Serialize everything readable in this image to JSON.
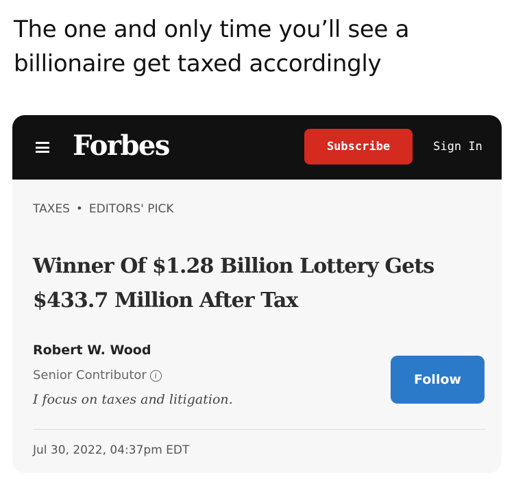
{
  "caption": {
    "line1": "The one and only time you’ll see a",
    "line2": "billionaire get taxed accordingly"
  },
  "navbar": {
    "logo": "Forbes",
    "subscribe_label": "Subscribe",
    "signin_label": "Sign In",
    "menu_icon": "hamburger-menu-icon",
    "background_color": "#111111",
    "subscribe_color": "#d42a1f"
  },
  "article": {
    "tags": [
      "TAXES",
      "EDITORS' PICK"
    ],
    "tag_separator": "•",
    "headline_line1": "Winner Of $1.28 Billion Lottery Gets",
    "headline_line2": "$433.7 Million After Tax",
    "author": {
      "name": "Robert W. Wood",
      "role": "Senior Contributor",
      "bio": "I focus on taxes and litigation.",
      "info_icon": "info-circle-icon",
      "info_glyph": "i"
    },
    "follow_label": "Follow",
    "follow_color": "#2b79c9",
    "published": "Jul 30, 2022, 04:37pm EDT"
  }
}
